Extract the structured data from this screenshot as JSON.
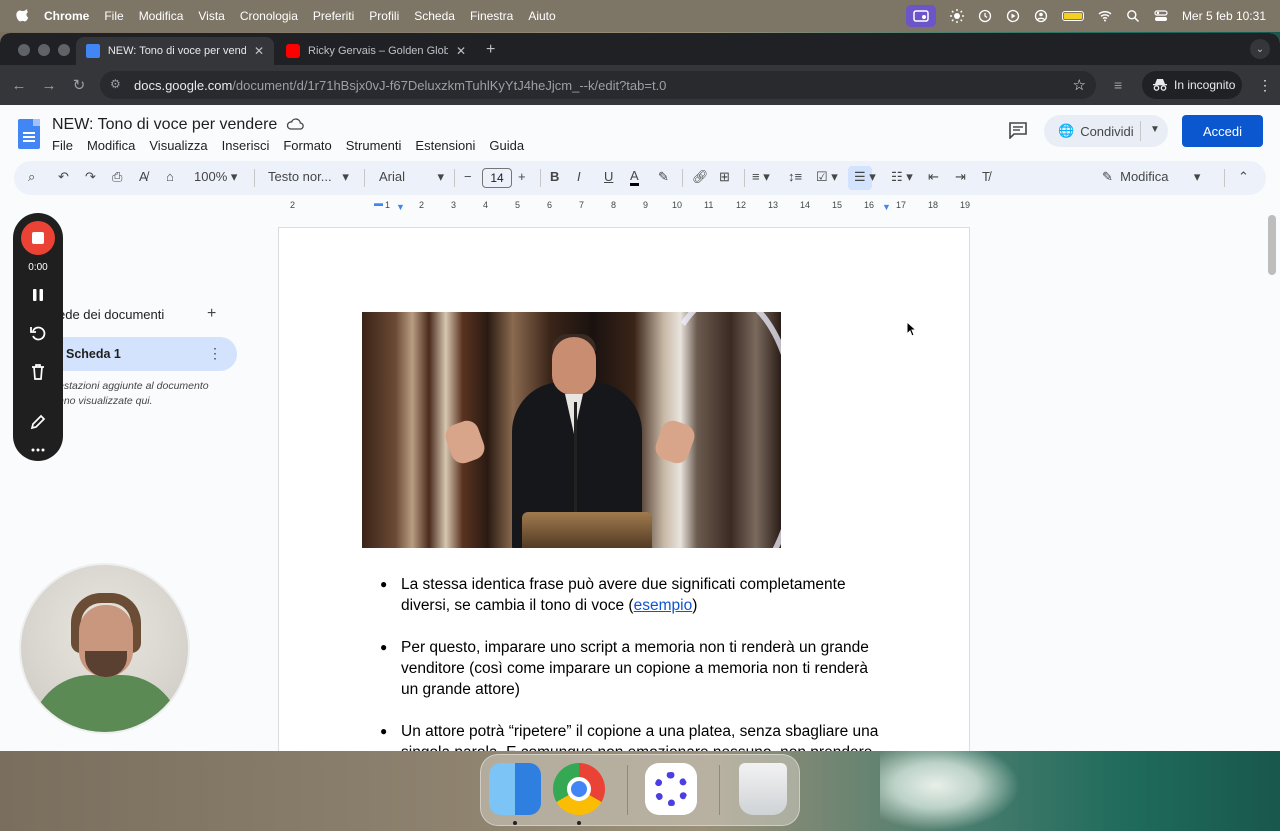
{
  "menubar": {
    "app": "Chrome",
    "items": [
      "File",
      "Modifica",
      "Vista",
      "Cronologia",
      "Preferiti",
      "Profili",
      "Scheda",
      "Finestra",
      "Aiuto"
    ],
    "datetime": "Mer 5 feb  10:31"
  },
  "browser": {
    "tabs": [
      {
        "title": "NEW: Tono di voce per vende",
        "icon": "google-docs-icon"
      },
      {
        "title": "Ricky Gervais – Golden Globe",
        "icon": "youtube-icon"
      }
    ],
    "url_host": "docs.google.com",
    "url_path": "/document/d/1r71hBsjx0vJ-f67DeluxzkmTuhlKyYtJ4heJjcm_--k/edit?tab=t.0",
    "incognito_label": "In incognito"
  },
  "docs": {
    "title": "NEW: Tono di voce per vendere",
    "menu": [
      "File",
      "Modifica",
      "Visualizza",
      "Inserisci",
      "Formato",
      "Strumenti",
      "Estensioni",
      "Guida"
    ],
    "share_label": "Condividi",
    "signin_label": "Accedi",
    "toolbar": {
      "zoom": "100%",
      "style": "Testo nor...",
      "font": "Arial",
      "font_size": "14",
      "mode": "Modifica"
    },
    "ruler": [
      "2",
      "1",
      "1",
      "2",
      "3",
      "4",
      "5",
      "6",
      "7",
      "8",
      "9",
      "10",
      "11",
      "12",
      "13",
      "14",
      "15",
      "16",
      "17",
      "18",
      "19"
    ],
    "sidebar": {
      "title": "ede dei documenti",
      "tab_label": "Scheda 1",
      "note": "estazioni aggiunte al documento\nnno visualizzate qui."
    },
    "bullets": [
      {
        "text_before": "La stessa identica frase può avere due significati completamente diversi, se cambia il tono di voce (",
        "link": "esempio",
        "text_after": ")"
      },
      {
        "text": "Per questo, imparare uno script a memoria non ti renderà un grande venditore (così come imparare un copione a memoria non ti renderà un grande attore)"
      },
      {
        "text": "Un attore potrà “ripetere” il copione a una platea, senza sbagliare una singola parola. E comunque non emozionare nessuno, non prendere"
      }
    ]
  },
  "recorder": {
    "time": "0:00"
  },
  "dock": {
    "apps": [
      "finder-icon",
      "chrome-icon",
      "screen-recorder-icon",
      "trash-icon"
    ]
  },
  "colors": {
    "accent": "#0b57d0",
    "record": "#ea4335",
    "link": "#1155cc"
  }
}
